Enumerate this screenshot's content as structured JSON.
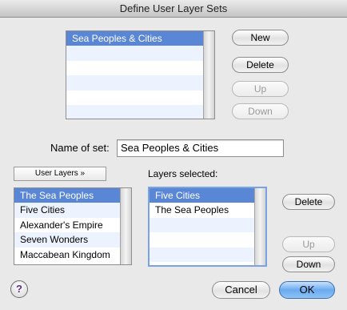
{
  "window": {
    "title": "Define User Layer Sets"
  },
  "sets_list": {
    "items": [
      {
        "label": "Sea Peoples & Cities",
        "selected": true
      }
    ]
  },
  "set_buttons": {
    "new": "New",
    "delete": "Delete",
    "up": "Up",
    "down": "Down"
  },
  "name_of_set": {
    "label": "Name of set:",
    "value": "Sea Peoples & Cities"
  },
  "user_layers_button": "User Layers »",
  "available_layers": {
    "items": [
      {
        "label": "The Sea Peoples",
        "selected": true
      },
      {
        "label": "Five Cities",
        "selected": false
      },
      {
        "label": "Alexander's Empire",
        "selected": false
      },
      {
        "label": "Seven Wonders",
        "selected": false
      },
      {
        "label": "Maccabean Kingdom",
        "selected": false
      }
    ]
  },
  "layers_selected": {
    "label": "Layers selected:",
    "items": [
      {
        "label": "Five Cities",
        "selected": true
      },
      {
        "label": "The Sea Peoples",
        "selected": false
      }
    ]
  },
  "selected_buttons": {
    "delete": "Delete",
    "up": "Up",
    "down": "Down"
  },
  "help": {
    "glyph": "?"
  },
  "footer": {
    "cancel": "Cancel",
    "ok": "OK"
  },
  "colors": {
    "selection": "#5a86d6",
    "accent": "#6aaaf0",
    "help_glyph": "#5a2d82"
  }
}
